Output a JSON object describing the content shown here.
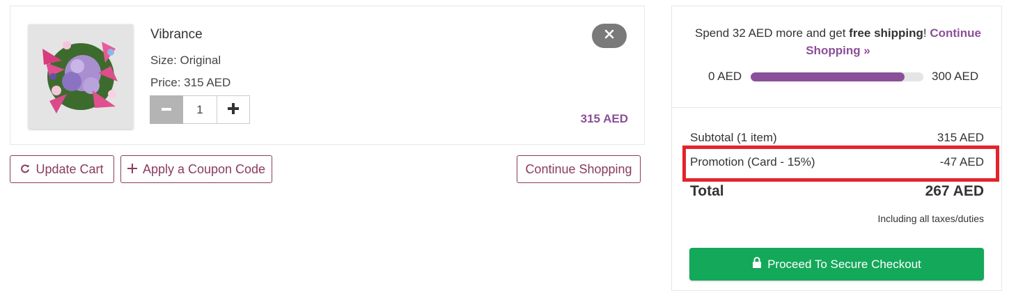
{
  "item": {
    "name": "Vibrance",
    "size": "Size: Original",
    "price": "Price: 315 AED",
    "quantity": "1",
    "line_total": "315 AED"
  },
  "actions": {
    "update_cart": "Update Cart",
    "apply_coupon": "Apply a Coupon Code",
    "continue_shopping": "Continue Shopping"
  },
  "shipping": {
    "msg_prefix": "Spend 32 AED more and get ",
    "msg_bold": "free shipping",
    "msg_suffix": "! ",
    "link": "Continue Shopping »",
    "bar_min": "0 AED",
    "bar_max": "300 AED",
    "progress_fraction": 0.893
  },
  "summary": {
    "subtotal_label": "Subtotal (1 item)",
    "subtotal_value": "315 AED",
    "promotion_label": "Promotion (Card - 15%)",
    "promotion_value": "-47 AED",
    "total_label": "Total",
    "total_value": "267 AED",
    "tax_note": "Including all taxes/duties",
    "checkout_label": "Proceed To Secure Checkout"
  },
  "colors": {
    "accent_purple": "#8b4f99",
    "button_outline": "#8b3a5e",
    "checkout_green": "#14a85a",
    "highlight_red": "#e5232b"
  }
}
